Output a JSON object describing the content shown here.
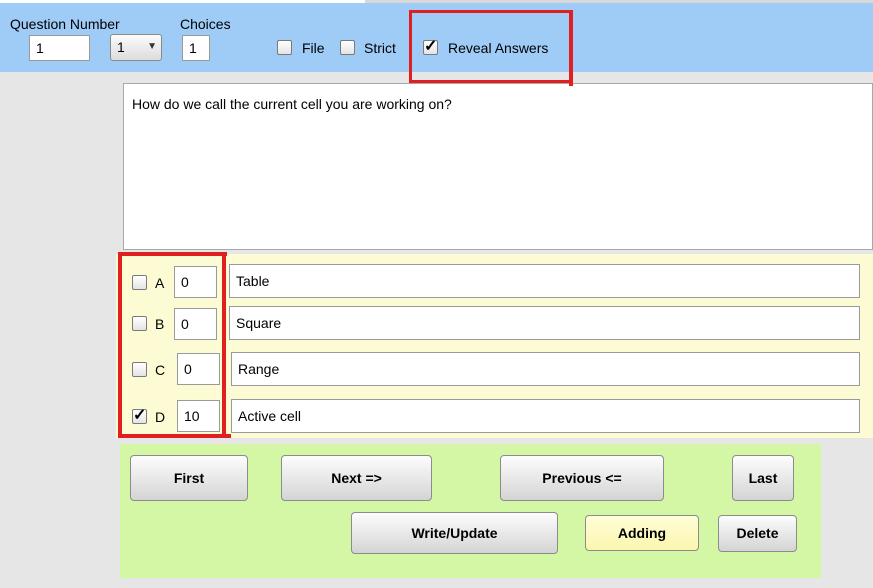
{
  "toolbar": {
    "question_number_label": "Question Number",
    "question_number_value": "1",
    "question_select_value": "1",
    "choices_label": "Choices",
    "choices_value": "1",
    "file_label": "File",
    "file_checked": false,
    "strict_label": "Strict",
    "strict_checked": false,
    "reveal_label": "Reveal Answers",
    "reveal_checked": true
  },
  "question": {
    "text": "How do we call the current cell you are working on?"
  },
  "choices": [
    {
      "letter": "A",
      "checked": false,
      "score": "0",
      "text": "Table"
    },
    {
      "letter": "B",
      "checked": false,
      "score": "0",
      "text": "Square"
    },
    {
      "letter": "C",
      "checked": false,
      "score": "0",
      "text": "Range"
    },
    {
      "letter": "D",
      "checked": true,
      "score": "10",
      "text": "Active cell"
    }
  ],
  "nav": {
    "first": "First",
    "next": "Next =>",
    "previous": "Previous <=",
    "last": "Last",
    "write_update": "Write/Update",
    "adding": "Adding",
    "delete": "Delete"
  },
  "colors": {
    "toolbar_bg": "#9fcbf7",
    "choices_bg": "#fdfbd3",
    "nav_bg": "#d3f7a4",
    "adding_bg": "#fbf6ae",
    "annotation_red": "#e02020"
  }
}
